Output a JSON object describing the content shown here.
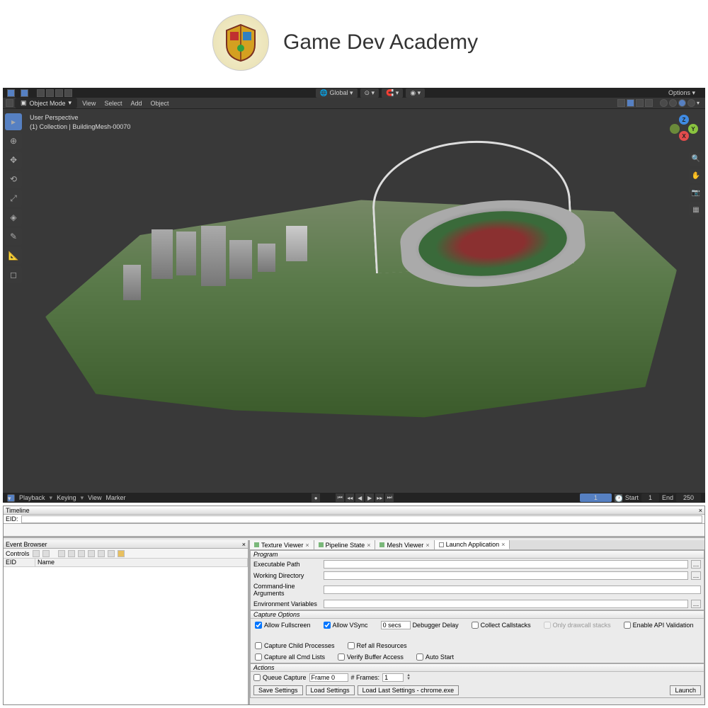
{
  "header": {
    "site_title": "Game Dev Academy"
  },
  "blender": {
    "orientation_mode": "Global",
    "options_label": "Options",
    "mode": "Object Mode",
    "menu": [
      "View",
      "Select",
      "Add",
      "Object"
    ],
    "overlay": {
      "line1": "User Perspective",
      "line2": "(1) Collection | BuildingMesh-00070"
    },
    "gizmo": {
      "z": "Z",
      "y": "Y",
      "x": "X"
    },
    "timeline": {
      "menu": [
        "Playback",
        "Keying",
        "View",
        "Marker"
      ],
      "frame": "1",
      "start_label": "Start",
      "start": "1",
      "end_label": "End",
      "end": "250"
    }
  },
  "renderdoc": {
    "timeline_title": "Timeline",
    "eid_label": "EID:",
    "event_browser_title": "Event Browser",
    "controls_label": "Controls",
    "tree_cols": {
      "eid": "EID",
      "name": "Name"
    },
    "tabs": [
      {
        "label": "Texture Viewer"
      },
      {
        "label": "Pipeline State"
      },
      {
        "label": "Mesh Viewer"
      },
      {
        "label": "Launch Application",
        "active": true
      }
    ],
    "program": {
      "title": "Program",
      "exe": "Executable Path",
      "wd": "Working Directory",
      "args": "Command-line Arguments",
      "env": "Environment Variables"
    },
    "capture": {
      "title": "Capture Options",
      "allow_fullscreen": "Allow Fullscreen",
      "allow_vsync": "Allow VSync",
      "delay_value": "0 secs",
      "delay_label": "Debugger Delay",
      "collect_callstacks": "Collect Callstacks",
      "only_drawcall": "Only drawcall stacks",
      "api_validation": "Enable API Validation",
      "child_processes": "Capture Child Processes",
      "ref_all": "Ref all Resources",
      "capture_cmd": "Capture all Cmd Lists",
      "verify_buffer": "Verify Buffer Access",
      "auto_start": "Auto Start"
    },
    "actions": {
      "title": "Actions",
      "queue_capture": "Queue Capture",
      "frame_value": "Frame 0",
      "num_frames_label": "# Frames:",
      "num_frames": "1",
      "save": "Save Settings",
      "load": "Load Settings",
      "load_last": "Load Last Settings - chrome.exe",
      "launch": "Launch"
    }
  }
}
